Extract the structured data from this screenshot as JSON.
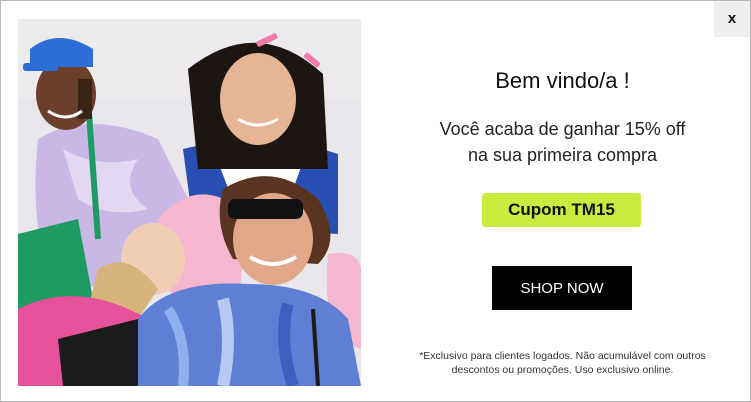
{
  "modal": {
    "close_label": "x",
    "photo_icon": "photo-illustration",
    "title": "Bem vindo/a !",
    "subtitle_lines": [
      "Você acaba de ganhar 15% off",
      "na sua primeira compra"
    ],
    "coupon_label": "Cupom TM15",
    "cta_label": "SHOP NOW",
    "disclaimer_lines": [
      "*Exclusivo para clientes logados. Não acumulável com outros",
      "descontos ou promoções. Uso exclusivo online."
    ]
  },
  "colors": {
    "coupon_bg": "#c9ea3f",
    "cta_bg": "#000000",
    "close_bg": "#eeeeee"
  }
}
